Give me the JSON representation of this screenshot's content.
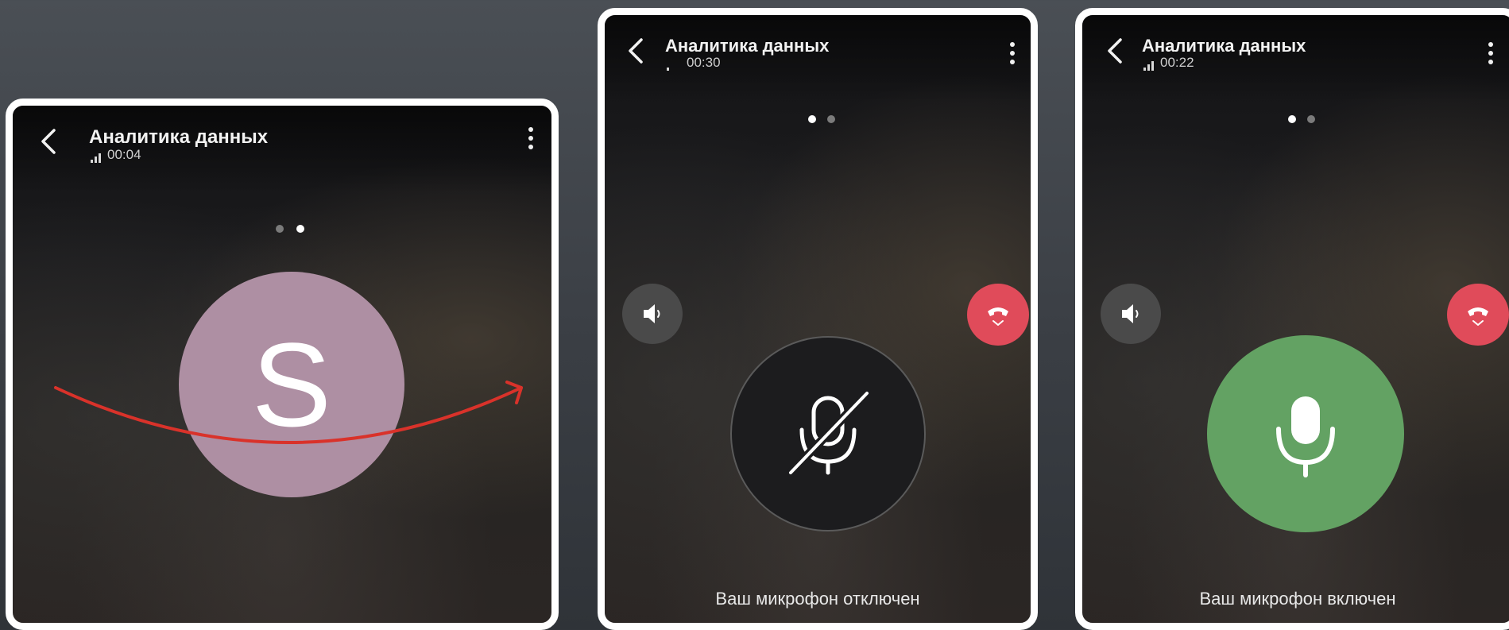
{
  "screens": [
    {
      "title": "Аналитика данных",
      "timer": "00:04",
      "avatar_letter": "S",
      "active_dot": 2,
      "status": ""
    },
    {
      "title": "Аналитика данных",
      "timer": "00:30",
      "active_dot": 1,
      "status": "Ваш микрофон отключен",
      "mic": "muted"
    },
    {
      "title": "Аналитика данных",
      "timer": "00:22",
      "active_dot": 1,
      "status": "Ваш микрофон включен",
      "mic": "on"
    }
  ],
  "colors": {
    "avatar": "#ae8fa3",
    "hangup": "#e04b5a",
    "mic_on": "#63a263",
    "mic_off": "#1c1c1e",
    "swipe_arrow": "#d9322a"
  },
  "icons": [
    "back-arrow-icon",
    "signal-icon",
    "more-vertical-icon",
    "speaker-icon",
    "hangup-icon",
    "chevron-down-icon",
    "microphone-icon",
    "microphone-off-icon",
    "swipe-arrow"
  ]
}
